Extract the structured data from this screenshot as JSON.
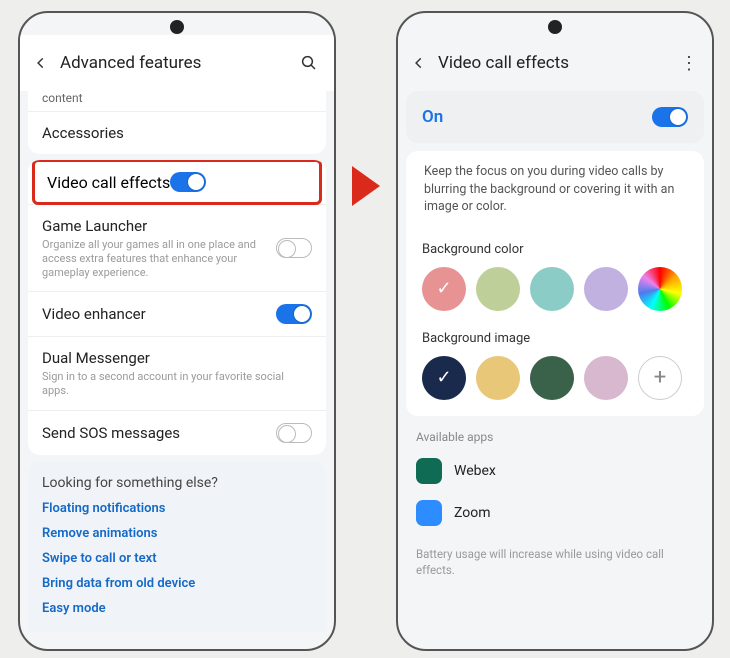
{
  "left": {
    "title": "Advanced features",
    "truncated_top": "content",
    "rows": {
      "accessories": "Accessories",
      "video_call_effects": "Video call effects",
      "game_launcher": {
        "label": "Game Launcher",
        "sub": "Organize all your games all in one place and access extra features that enhance your gameplay experience."
      },
      "video_enhancer": "Video enhancer",
      "dual_messenger": {
        "label": "Dual Messenger",
        "sub": "Sign in to a second account in your favorite social apps."
      },
      "send_sos": "Send SOS messages"
    },
    "footer": {
      "title": "Looking for something else?",
      "links": [
        "Floating notifications",
        "Remove animations",
        "Swipe to call or text",
        "Bring data from old device",
        "Easy mode"
      ]
    }
  },
  "right": {
    "title": "Video call effects",
    "on_label": "On",
    "description": "Keep the focus on you during video calls by blurring the background or covering it with an image or color.",
    "bg_color_title": "Background color",
    "bg_colors": [
      "#e89393",
      "#bfcf9a",
      "#8cccc6",
      "#c0b1e0",
      "rainbow"
    ],
    "bg_color_selected": 0,
    "bg_image_title": "Background image",
    "bg_images": [
      "#1a2a4d",
      "#e8c779",
      "#3a614a",
      "#d8b8cf"
    ],
    "bg_image_selected": 0,
    "available_title": "Available apps",
    "apps": [
      {
        "name": "Webex",
        "color": "#0f6b54"
      },
      {
        "name": "Zoom",
        "color": "#2d8cff"
      }
    ],
    "footnote": "Battery usage will increase while using video call effects."
  }
}
